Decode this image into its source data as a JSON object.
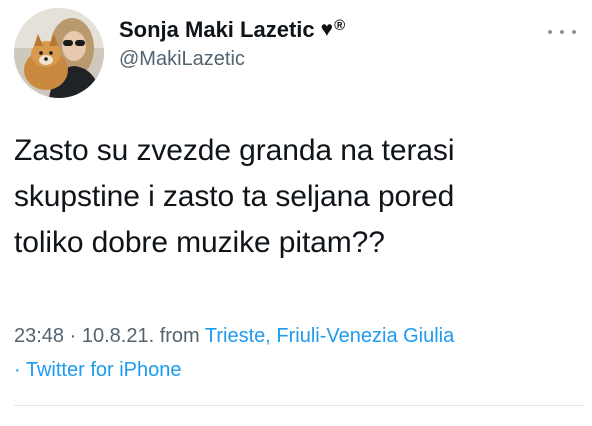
{
  "author": {
    "display_name": "Sonja Maki Lazetic",
    "heart_glyph": "♥",
    "reg_glyph": "®",
    "handle": "@MakiLazetic"
  },
  "tweet": {
    "lines": [
      "Zasto su zvezde granda na terasi",
      "skupstine i zasto ta seljana pored",
      "toliko dobre muzike pitam??"
    ]
  },
  "meta": {
    "time": "23:48",
    "sep1": " · ",
    "date": "10.8.21.",
    "from_text": " from ",
    "location": "Trieste, Friuli-Venezia Giulia",
    "sep2": "· ",
    "source": "Twitter for iPhone"
  },
  "colors": {
    "text": "#0f1419",
    "secondary": "#536471",
    "link": "#1d9bf0",
    "divider": "#e3e7ea"
  },
  "icons": {
    "more": "more-horizontal-icon",
    "verified_heart": "heart-icon"
  }
}
